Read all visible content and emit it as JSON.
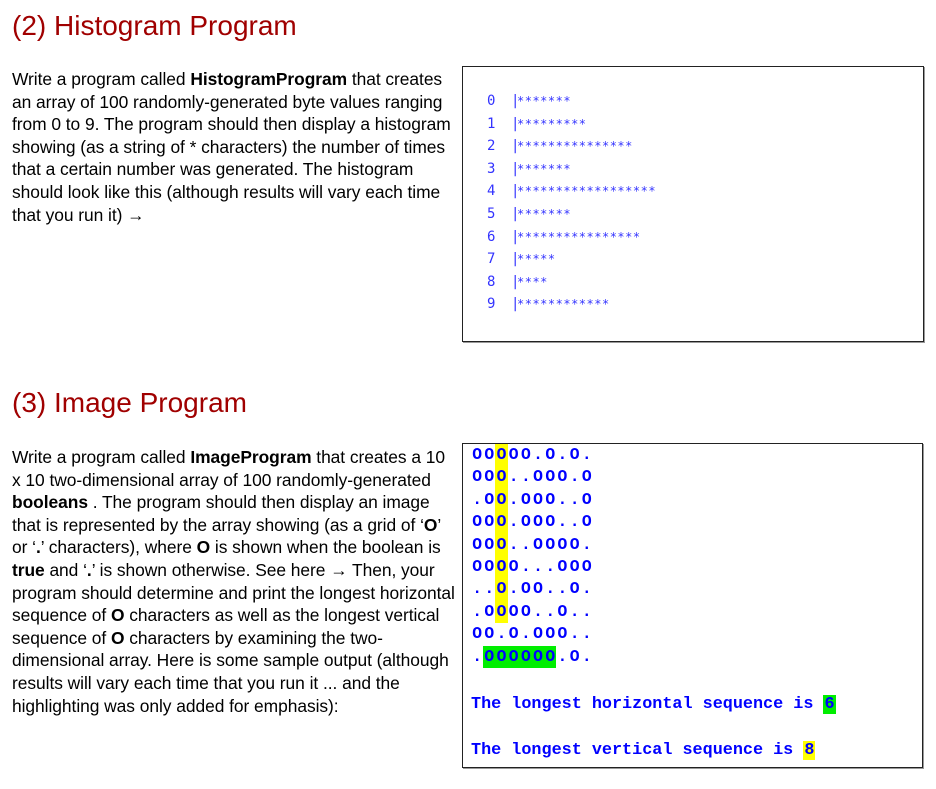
{
  "section2": {
    "heading": "(2) Histogram Program",
    "paragraph": {
      "before_bold": "Write a program called ",
      "bold_name": "HistogramProgram",
      "after_bold": " that creates an array of 100 randomly-generated byte values ranging from 0 to 9.   The program should then display a histogram showing (as a string of * characters) the number of times that a certain number was generated.  The histogram should look like this (although results will vary each time that you run it) →"
    },
    "histogram": {
      "separator": "|",
      "symbol": "*",
      "rows": [
        {
          "label": "0",
          "count": 7
        },
        {
          "label": "1",
          "count": 9
        },
        {
          "label": "2",
          "count": 15
        },
        {
          "label": "3",
          "count": 7
        },
        {
          "label": "4",
          "count": 18
        },
        {
          "label": "5",
          "count": 7
        },
        {
          "label": "6",
          "count": 16
        },
        {
          "label": "7",
          "count": 5
        },
        {
          "label": "8",
          "count": 4
        },
        {
          "label": "9",
          "count": 12
        }
      ]
    }
  },
  "section3": {
    "heading": "(3) Image Program",
    "paragraph": {
      "t1": "Write a program called ",
      "b1": "ImageProgram",
      "t2": " that creates a 10 x 10 two-dimensional array of 100 randomly-generated ",
      "b2": "booleans",
      "t3": " .   The program should then display an image that is represented by the array showing (as a grid of ‘",
      "b3": "O",
      "t4": "’ or ‘",
      "b4": ".",
      "t5": "’ characters), where ",
      "b5": "O",
      "t6": " is shown when the boolean is ",
      "b6": "true",
      "t7": " and ‘",
      "b7": ".",
      "t8": "’ is shown otherwise.   See here → Then, your program should determine and print the longest horizontal sequence of ",
      "b8": "O",
      "t9": " characters as well as the longest vertical sequence of ",
      "b9": "O",
      "t10": " characters by examining the two-dimensional array.   Here is some sample output (although results will vary each time that you run it ... and the highlighting was only added for emphasis):"
    },
    "image": {
      "rows": [
        "OOOOO.O.O.",
        "OOO..OOO.O",
        ".OO.OOO..O",
        "OOO.OOO..O",
        "OOO..OOOO.",
        "OOOO...OOO",
        "..O.OO..O.",
        ".OOOO..O..",
        "OO.O.OOO..",
        ".OOOOOO.O."
      ],
      "vertical_highlight": {
        "column": 2,
        "from_row": 0,
        "to_row": 7,
        "color": "#ffff00"
      },
      "horizontal_highlight": {
        "row": 9,
        "from_col": 1,
        "to_col": 6,
        "color": "#00ee00"
      }
    },
    "results": {
      "horizontal_label": "The longest horizontal sequence is ",
      "horizontal_value": "6",
      "vertical_label": "The longest vertical sequence is ",
      "vertical_value": "8"
    }
  },
  "colors": {
    "heading": "#a00000",
    "histogram_text": "#3333ff",
    "image_text": "#0000ff"
  }
}
